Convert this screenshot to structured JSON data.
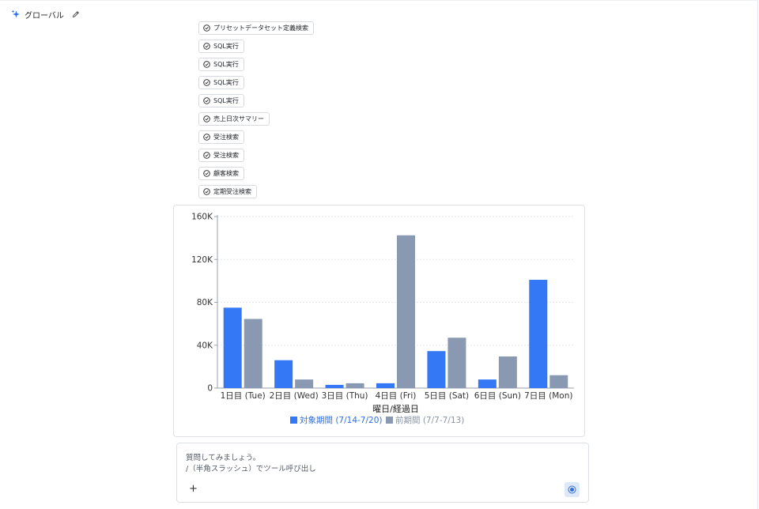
{
  "header": {
    "title": "グローバル",
    "icon": "sparkle-icon",
    "edit_icon": "pencil-icon"
  },
  "tools": [
    {
      "label": "プリセットデータセット定義検索"
    },
    {
      "label": "SQL実行"
    },
    {
      "label": "SQL実行"
    },
    {
      "label": "SQL実行"
    },
    {
      "label": "SQL実行"
    },
    {
      "label": "売上日次サマリー"
    },
    {
      "label": "受注検索"
    },
    {
      "label": "受注検索"
    },
    {
      "label": "顧客検索"
    },
    {
      "label": "定期受注検索"
    }
  ],
  "chart_data": {
    "type": "bar",
    "categories": [
      "1日目 (Tue)",
      "2日目 (Wed)",
      "3日目 (Thu)",
      "4日目 (Fri)",
      "5日目 (Sat)",
      "6日目 (Sun)",
      "7日目 (Mon)"
    ],
    "series": [
      {
        "name": "対象期間 (7/14-7/20)",
        "color": "#3478f6",
        "values": [
          75000,
          26000,
          3000,
          4500,
          34500,
          8000,
          101000
        ]
      },
      {
        "name": "前期間 (7/7-7/13)",
        "color": "#8a99b2",
        "values": [
          64500,
          8000,
          4500,
          142500,
          47000,
          29500,
          12000
        ]
      }
    ],
    "yticks": [
      "0",
      "40K",
      "80K",
      "120K",
      "160K"
    ],
    "ylim": [
      0,
      160000
    ],
    "xlabel": "曜日/経過日",
    "ylabel": "",
    "grid": true,
    "legend_position": "bottom"
  },
  "composer": {
    "placeholder_line1": "質問してみましょう。",
    "placeholder_line2": "/（半角スラッシュ）でツール呼び出し",
    "plus_label": "+",
    "send_icon": "stop-circle-icon"
  }
}
